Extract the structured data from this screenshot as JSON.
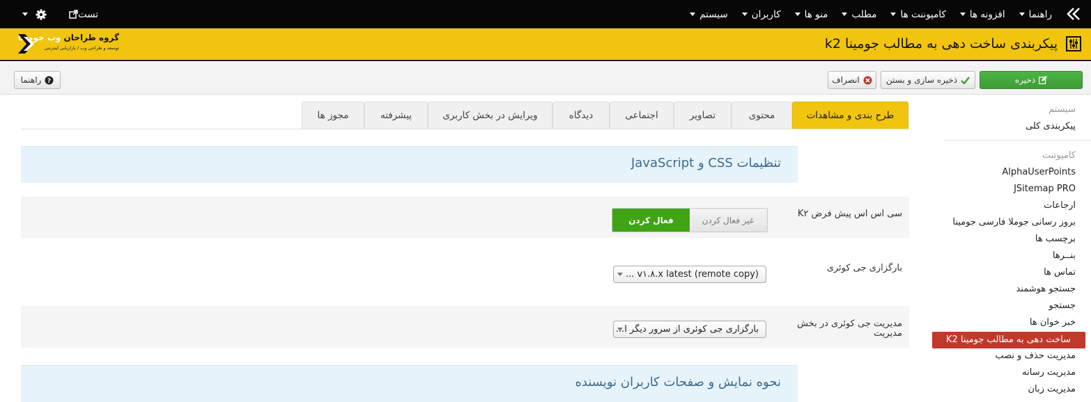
{
  "topnav": {
    "menu": [
      {
        "label": "سیستم"
      },
      {
        "label": "کاربران"
      },
      {
        "label": "منو ها"
      },
      {
        "label": "مطلب"
      },
      {
        "label": "کامپوننت ها"
      },
      {
        "label": "افزونه ها"
      },
      {
        "label": "راهنما"
      }
    ],
    "site_label": "تست"
  },
  "header": {
    "title": "پیکربندی ساخت دهی به مطالب جومینا k2",
    "logo_text_main": "گروه طراحان",
    "logo_text_accent": "وب جومینا",
    "logo_subtitle": "توسعه و طراحی وب / بازاریابی اینترنتی"
  },
  "toolbar": {
    "save": "ذخیره",
    "save_close": "ذخیره سازی و بستن",
    "cancel": "انصراف",
    "help": "راهنما"
  },
  "sidebar": {
    "system_heading": "سیستم",
    "system_items": [
      "پیکربندی کلی"
    ],
    "component_heading": "کامپوننت",
    "component_items": [
      "AlphaUserPoints",
      "JSitemap PRO",
      "ارجاعات",
      "بروز رسانی جوملا فارسی جومینا",
      "برچسب ها",
      "بنــرها",
      "تماس ها",
      "جستجو هوشمند",
      "جستجو",
      "خبر خوان ها",
      "ساخت دهی به مطالب جومینا K2",
      "مدیریت حذف و نصب",
      "مدیریت رسانه",
      "مدیریت زبان"
    ],
    "active_index": 10
  },
  "tabs": [
    {
      "label": "طرح بندی و مشاهدات",
      "active": true
    },
    {
      "label": "محتوی",
      "active": false
    },
    {
      "label": "تصاویر",
      "active": false
    },
    {
      "label": "اجتماعی",
      "active": false
    },
    {
      "label": "دیدگاه",
      "active": false
    },
    {
      "label": "ویرایش در بخش کاربری",
      "active": false
    },
    {
      "label": "پیشرفته",
      "active": false
    },
    {
      "label": "مجوز ها",
      "active": false
    }
  ],
  "content": {
    "section1_title": "تنظیمات CSS و JavaScript",
    "k2_css_label": "سی اس اس پیش فرض K۲",
    "toggle_off": "غیر فعال کردن",
    "toggle_on": "فعال کردن",
    "toggle_state": "on",
    "jquery_label": "بارگزاری جی کوئری",
    "jquery_value": "v۱.۸.x latest (remote copy) ...",
    "jquery_admin_label": "مدیریت جی کوئری در بخش مدیریت",
    "jquery_admin_value": "بارگزاری جی کوئری از سرور دیگر ا...",
    "section2_title": "نحوه نمایش و صفحات کاربران نویسنده"
  },
  "colors": {
    "accent": "#f1c40f",
    "topbar": "#070707",
    "save_green": "#43ac3b",
    "active_sidebar": "#c0392b",
    "toggle_on_green": "#3fa516",
    "section_bg": "#e6f3fb"
  }
}
